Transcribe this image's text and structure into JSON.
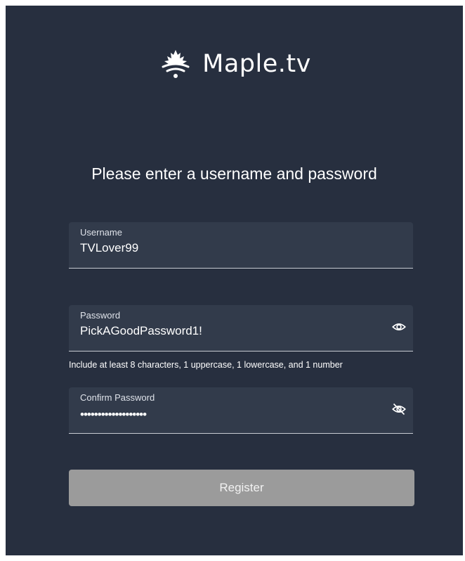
{
  "brand": {
    "name": "Maple.tv",
    "logo_icon": "maple-leaf-wifi-icon"
  },
  "heading": "Please enter a username and password",
  "form": {
    "username": {
      "label": "Username",
      "value": "TVLover99"
    },
    "password": {
      "label": "Password",
      "value": "PickAGoodPassword1!",
      "toggle_icon": "eye-icon"
    },
    "password_hint": "Include at least 8 characters, 1 uppercase, 1 lowercase, and 1 number",
    "confirm_password": {
      "label": "Confirm Password",
      "masked_value": "•••••••••••••••••••",
      "toggle_icon": "eye-off-icon"
    },
    "register_label": "Register"
  },
  "colors": {
    "background": "#272f3f",
    "field_background": "#323b4b",
    "button_disabled": "#9b9b9b",
    "text": "#ffffff"
  }
}
